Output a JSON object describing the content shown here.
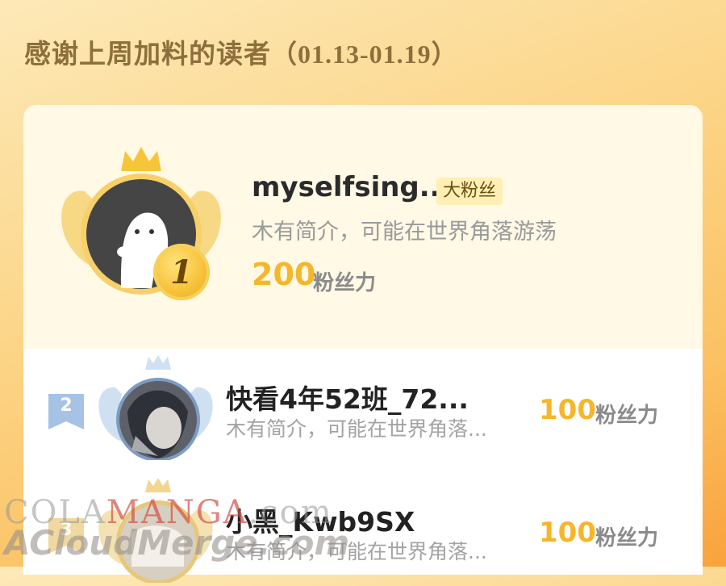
{
  "header": {
    "title": "感谢上周加料的读者",
    "date_range": "（01.13-01.19）"
  },
  "top_reader": {
    "rank": "1",
    "name": "myselfsing...",
    "badge": "大粉丝",
    "description": "木有简介，可能在世界角落游荡",
    "power": "200",
    "power_unit": "粉丝力",
    "avatar_icon": "ghost-avatar-icon"
  },
  "readers": [
    {
      "rank": "2",
      "name": "快看4年52班_72...",
      "description": "木有简介，可能在世界角落...",
      "power": "100",
      "power_unit": "粉丝力"
    },
    {
      "rank": "3",
      "name": "小黑_Kwb9SX",
      "description": "木有简介，可能在世界角落...",
      "power": "100",
      "power_unit": "粉丝力"
    }
  ],
  "watermark": {
    "line1_a": "COLA",
    "line1_b": "MANGA",
    "line1_c": ".com",
    "line2": "ACloudMerge.com"
  },
  "colors": {
    "accent": "#f5b62b",
    "title": "#8d6f3c",
    "badge_bg": "#ffefb5"
  }
}
